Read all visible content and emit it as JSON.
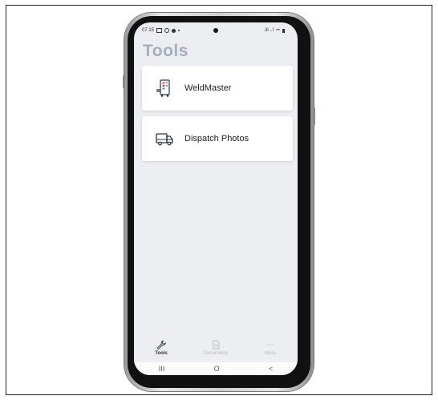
{
  "status_bar": {
    "time": "07.15",
    "signal_text": ".ill ..l"
  },
  "page": {
    "title": "Tools"
  },
  "tools": [
    {
      "label": "WeldMaster",
      "icon": "weld-machine-icon"
    },
    {
      "label": "Dispatch Photos",
      "icon": "truck-icon"
    }
  ],
  "bottom_nav": {
    "items": [
      {
        "label": "Tools",
        "icon": "wrench-icon",
        "active": true
      },
      {
        "label": "Documents",
        "icon": "document-icon",
        "active": false
      },
      {
        "label": "More",
        "icon": "more-dots-icon",
        "active": false
      }
    ]
  },
  "system_nav": {
    "recents": "III",
    "home": "O",
    "back": "<"
  },
  "colors": {
    "screen_bg": "#eceef1",
    "title": "#a5afbf",
    "active_nav": "#2b3440",
    "inactive_nav": "#b6bcc6"
  }
}
